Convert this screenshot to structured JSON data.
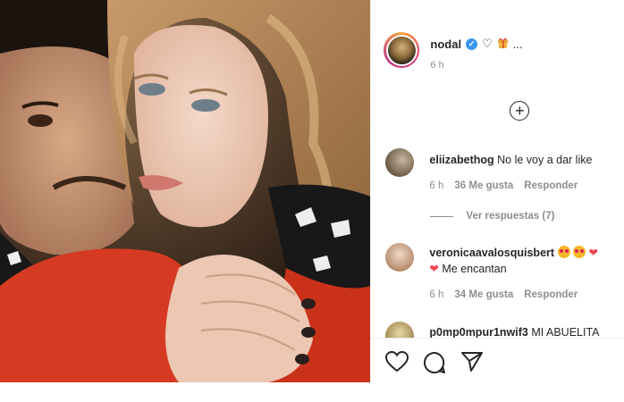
{
  "post": {
    "author": {
      "username": "nodal",
      "verified_mark": "✓",
      "caption": "♡",
      "caption_suffix": "...",
      "gift_icon": "gift-icon",
      "time": "6 h"
    },
    "add_comment_icon": "+"
  },
  "comments": [
    {
      "username": "eliizabethog",
      "text": "No le voy a dar like",
      "time": "6 h",
      "likes": "36 Me gusta",
      "reply": "Responder",
      "view_replies": "Ver respuestas (7)"
    },
    {
      "username": "veronicaavalosquisbert",
      "text": "Me encantan",
      "time": "6 h",
      "likes": "34 Me gusta",
      "reply": "Responder"
    },
    {
      "username": "p0mp0mpur1nwif3",
      "text": "MI ABUELITA"
    }
  ],
  "actions": {
    "like": "heart-icon",
    "comment": "comment-icon",
    "share": "send-icon"
  },
  "colors": {
    "text": "#262626",
    "muted": "#8e8e8e",
    "verified": "#3897f0",
    "heart": "#ed4956"
  }
}
